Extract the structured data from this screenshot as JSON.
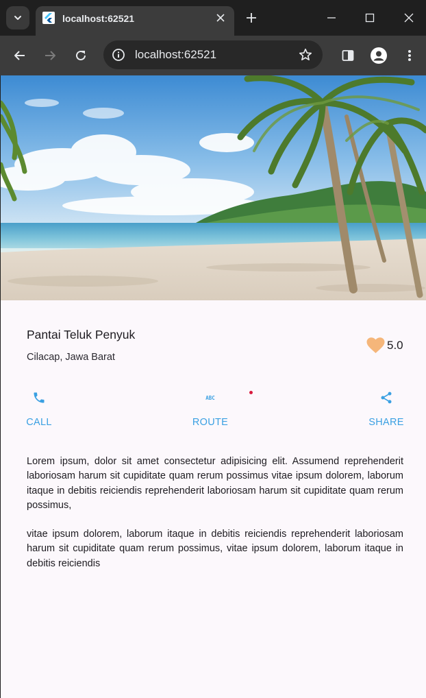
{
  "browser": {
    "tab_title": "localhost:62521",
    "url": "localhost:62521"
  },
  "place": {
    "title": "Pantai Teluk Penyuk",
    "location": "Cilacap, Jawa Barat",
    "rating": "5.0"
  },
  "actions": [
    {
      "label": "CALL",
      "icon": "phone-icon"
    },
    {
      "label": "ROUTE",
      "icon": "abc-icon"
    },
    {
      "label": "SHARE",
      "icon": "share-icon"
    }
  ],
  "description": [
    "Lorem ipsum, dolor sit amet consectetur adipisicing elit. Assumend reprehenderit laboriosam harum sit cupiditate quam rerum possimus vitae ipsum dolorem, laborum itaque in debitis reiciendis reprehenderit laboriosam harum sit cupiditate quam rerum  possimus,",
    "vitae ipsum dolorem, laborum itaque in debitis reiciendis reprehenderit laboriosam harum sit cupiditate quam rerum possimus, vitae ipsum dolorem, laborum itaque in debitis reiciendis"
  ],
  "colors": {
    "accent": "#3aa0e2",
    "heart": "#f5b67a",
    "page_bg": "#fcf8fc"
  }
}
